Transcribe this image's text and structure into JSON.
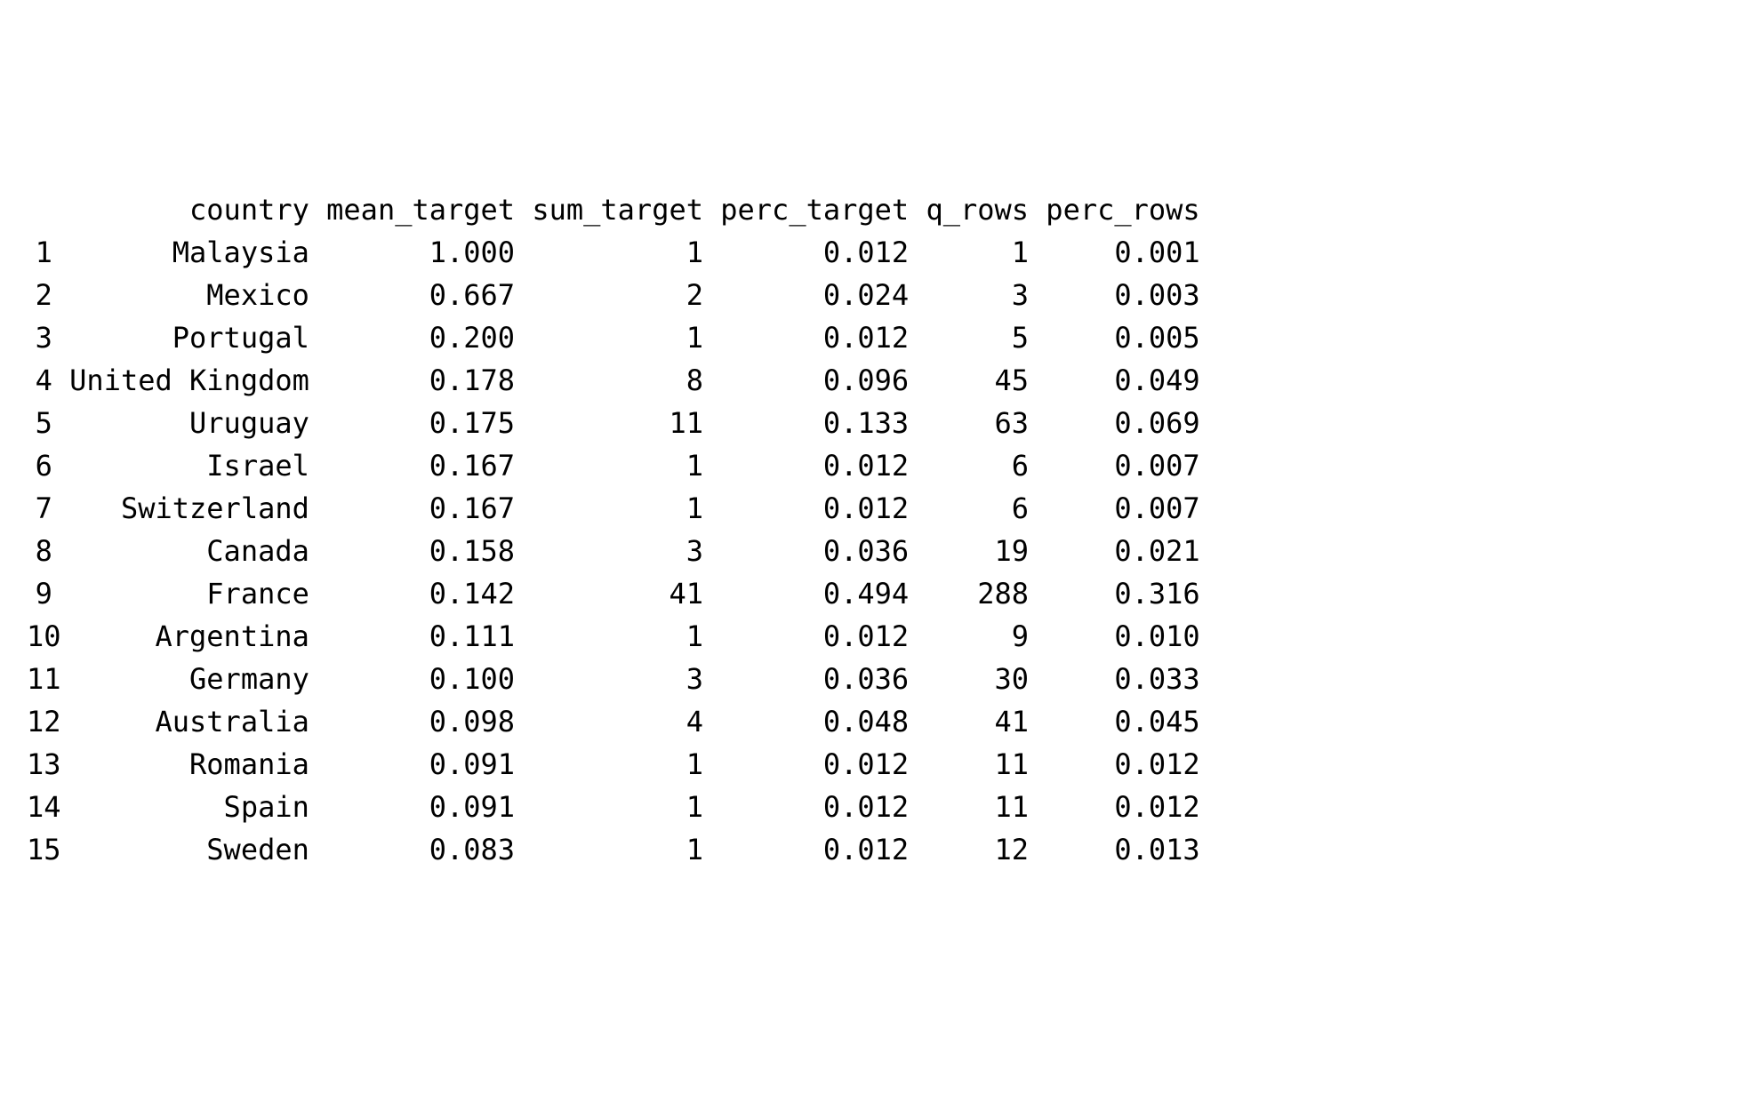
{
  "columns": [
    "country",
    "mean_target",
    "sum_target",
    "perc_target",
    "q_rows",
    "perc_rows"
  ],
  "rows": [
    {
      "idx": "1",
      "country": "Malaysia",
      "mean_target": "1.000",
      "sum_target": "1",
      "perc_target": "0.012",
      "q_rows": "1",
      "perc_rows": "0.001"
    },
    {
      "idx": "2",
      "country": "Mexico",
      "mean_target": "0.667",
      "sum_target": "2",
      "perc_target": "0.024",
      "q_rows": "3",
      "perc_rows": "0.003"
    },
    {
      "idx": "3",
      "country": "Portugal",
      "mean_target": "0.200",
      "sum_target": "1",
      "perc_target": "0.012",
      "q_rows": "5",
      "perc_rows": "0.005"
    },
    {
      "idx": "4",
      "country": "United Kingdom",
      "mean_target": "0.178",
      "sum_target": "8",
      "perc_target": "0.096",
      "q_rows": "45",
      "perc_rows": "0.049"
    },
    {
      "idx": "5",
      "country": "Uruguay",
      "mean_target": "0.175",
      "sum_target": "11",
      "perc_target": "0.133",
      "q_rows": "63",
      "perc_rows": "0.069"
    },
    {
      "idx": "6",
      "country": "Israel",
      "mean_target": "0.167",
      "sum_target": "1",
      "perc_target": "0.012",
      "q_rows": "6",
      "perc_rows": "0.007"
    },
    {
      "idx": "7",
      "country": "Switzerland",
      "mean_target": "0.167",
      "sum_target": "1",
      "perc_target": "0.012",
      "q_rows": "6",
      "perc_rows": "0.007"
    },
    {
      "idx": "8",
      "country": "Canada",
      "mean_target": "0.158",
      "sum_target": "3",
      "perc_target": "0.036",
      "q_rows": "19",
      "perc_rows": "0.021"
    },
    {
      "idx": "9",
      "country": "France",
      "mean_target": "0.142",
      "sum_target": "41",
      "perc_target": "0.494",
      "q_rows": "288",
      "perc_rows": "0.316"
    },
    {
      "idx": "10",
      "country": "Argentina",
      "mean_target": "0.111",
      "sum_target": "1",
      "perc_target": "0.012",
      "q_rows": "9",
      "perc_rows": "0.010"
    },
    {
      "idx": "11",
      "country": "Germany",
      "mean_target": "0.100",
      "sum_target": "3",
      "perc_target": "0.036",
      "q_rows": "30",
      "perc_rows": "0.033"
    },
    {
      "idx": "12",
      "country": "Australia",
      "mean_target": "0.098",
      "sum_target": "4",
      "perc_target": "0.048",
      "q_rows": "41",
      "perc_rows": "0.045"
    },
    {
      "idx": "13",
      "country": "Romania",
      "mean_target": "0.091",
      "sum_target": "1",
      "perc_target": "0.012",
      "q_rows": "11",
      "perc_rows": "0.012"
    },
    {
      "idx": "14",
      "country": "Spain",
      "mean_target": "0.091",
      "sum_target": "1",
      "perc_target": "0.012",
      "q_rows": "11",
      "perc_rows": "0.012"
    },
    {
      "idx": "15",
      "country": "Sweden",
      "mean_target": "0.083",
      "sum_target": "1",
      "perc_target": "0.012",
      "q_rows": "12",
      "perc_rows": "0.013"
    }
  ]
}
